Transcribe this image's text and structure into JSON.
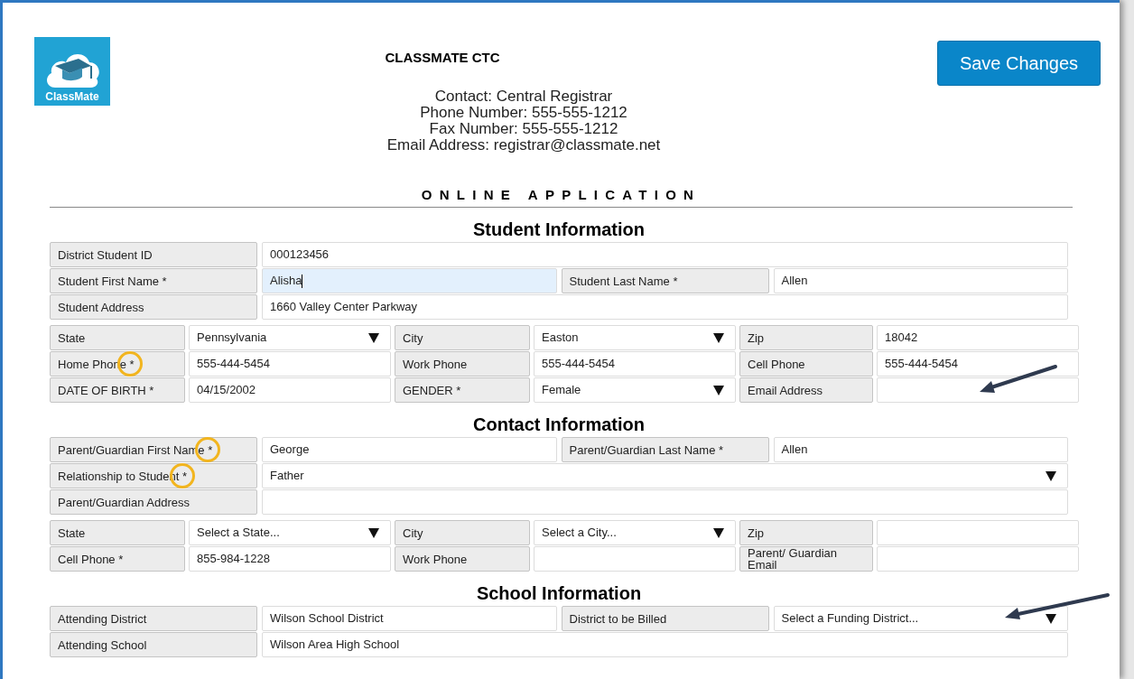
{
  "header": {
    "logo_text": "ClassMate",
    "org_name": "CLASSMATE CTC",
    "contact_lines": [
      "Contact: Central Registrar",
      "Phone Number: 555-555-1212",
      "Fax Number: 555-555-1212",
      "Email Address: registrar@classmate.net"
    ]
  },
  "save_button": "Save Changes",
  "form_title": "ONLINE APPLICATION",
  "sections": [
    {
      "title": "Student Information",
      "rows": [
        {
          "kind": "full",
          "fields": [
            {
              "label": "District Student ID",
              "value": "000123456",
              "kind": "text"
            }
          ]
        },
        {
          "kind": "pair",
          "fields": [
            {
              "label": "Student First Name *",
              "value": "Alisha",
              "kind": "text",
              "focused": true
            },
            {
              "label": "Student Last Name *",
              "value": "Allen",
              "kind": "text"
            }
          ]
        },
        {
          "kind": "full",
          "fields": [
            {
              "label": "Student Address",
              "value": "1660 Valley Center Parkway",
              "kind": "text"
            }
          ]
        },
        {
          "kind": "triple",
          "fields": [
            {
              "label": "State",
              "value": "Pennsylvania",
              "kind": "select"
            },
            {
              "label": "City",
              "value": "Easton",
              "kind": "select"
            },
            {
              "label": "Zip",
              "value": "18042",
              "kind": "text"
            }
          ]
        },
        {
          "kind": "triple",
          "fields": [
            {
              "label": "Home Phone *",
              "value": "555-444-5454",
              "kind": "text",
              "circled": true
            },
            {
              "label": "Work Phone",
              "value": "555-444-5454",
              "kind": "text"
            },
            {
              "label": "Cell Phone",
              "value": "555-444-5454",
              "kind": "text"
            }
          ]
        },
        {
          "kind": "triple",
          "fields": [
            {
              "label": "DATE OF BIRTH *",
              "value": "04/15/2002",
              "kind": "text"
            },
            {
              "label": "GENDER *",
              "value": "Female",
              "kind": "select"
            },
            {
              "label": "Email Address",
              "kind": "text",
              "pointed": true
            }
          ]
        }
      ]
    },
    {
      "title": "Contact Information",
      "rows": [
        {
          "kind": "pair",
          "fields": [
            {
              "label": "Parent/Guardian First Name *",
              "value": "George",
              "kind": "text",
              "circled": true
            },
            {
              "label": "Parent/Guardian Last Name *",
              "value": "Allen",
              "kind": "text"
            }
          ]
        },
        {
          "kind": "full",
          "fields": [
            {
              "label": "Relationship to Student *",
              "value": "Father",
              "kind": "select",
              "circled": true
            }
          ]
        },
        {
          "kind": "full",
          "fields": [
            {
              "label": "Parent/Guardian Address",
              "kind": "text"
            }
          ]
        },
        {
          "kind": "triple",
          "fields": [
            {
              "label": "State",
              "value": "Select a State...",
              "kind": "select"
            },
            {
              "label": "City",
              "value": "Select a City...",
              "kind": "select"
            },
            {
              "label": "Zip",
              "kind": "text"
            }
          ]
        },
        {
          "kind": "triple",
          "fields": [
            {
              "label": "Cell Phone *",
              "value": "855-984-1228",
              "kind": "text"
            },
            {
              "label": "Work Phone",
              "kind": "text"
            },
            {
              "label": "Parent/ Guardian Email",
              "kind": "text"
            }
          ]
        }
      ]
    },
    {
      "title": "School Information",
      "rows": [
        {
          "kind": "pair",
          "fields": [
            {
              "label": "Attending District",
              "value": "Wilson School District",
              "kind": "text"
            },
            {
              "label": "District to be Billed",
              "value": "Select a Funding District...",
              "kind": "select",
              "pointed": true
            }
          ]
        },
        {
          "kind": "full",
          "fields": [
            {
              "label": "Attending School",
              "value": "Wilson Area High School",
              "kind": "text"
            }
          ]
        }
      ]
    }
  ]
}
